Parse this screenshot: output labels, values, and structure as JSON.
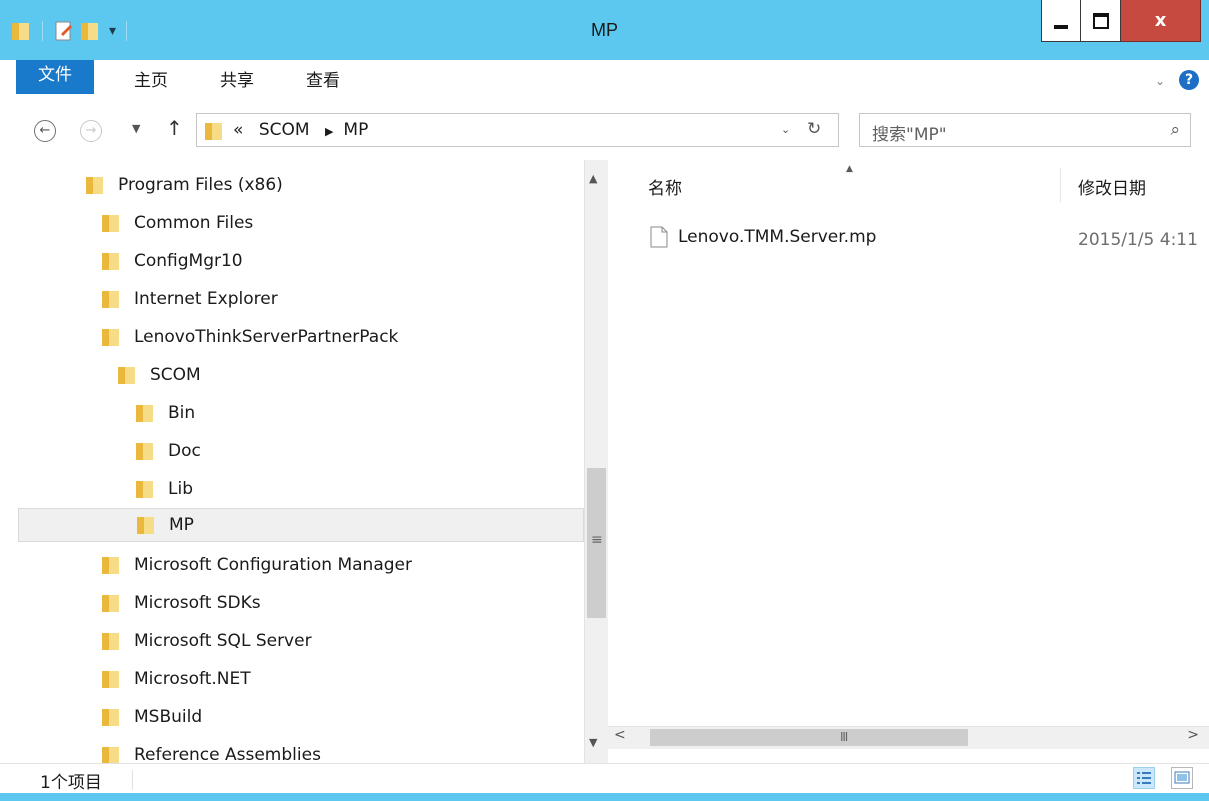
{
  "window": {
    "title": "MP"
  },
  "ribbon": {
    "tabs": [
      "文件",
      "主页",
      "共享",
      "查看"
    ]
  },
  "address": {
    "crumbs": [
      "«",
      "SCOM",
      "MP"
    ],
    "search_placeholder": "搜索\"MP\""
  },
  "nav_tree": [
    {
      "label": "Program Files (x86)",
      "level": 0
    },
    {
      "label": "Common Files",
      "level": 1
    },
    {
      "label": "ConfigMgr10",
      "level": 1
    },
    {
      "label": "Internet Explorer",
      "level": 1
    },
    {
      "label": "LenovoThinkServerPartnerPack",
      "level": 1
    },
    {
      "label": "SCOM",
      "level": 2
    },
    {
      "label": "Bin",
      "level": 3
    },
    {
      "label": "Doc",
      "level": 3
    },
    {
      "label": "Lib",
      "level": 3
    },
    {
      "label": "MP",
      "level": 3,
      "selected": true
    },
    {
      "label": "Microsoft Configuration Manager",
      "level": 1
    },
    {
      "label": "Microsoft SDKs",
      "level": 1
    },
    {
      "label": "Microsoft SQL Server",
      "level": 1
    },
    {
      "label": "Microsoft.NET",
      "level": 1
    },
    {
      "label": "MSBuild",
      "level": 1
    },
    {
      "label": "Reference Assemblies",
      "level": 1
    }
  ],
  "content": {
    "columns": [
      "名称",
      "修改日期"
    ],
    "files": [
      {
        "name": "Lenovo.TMM.Server.mp",
        "modified": "2015/1/5 4:11"
      }
    ]
  },
  "status": {
    "count": "1个项目"
  },
  "colors": {
    "chrome": "#5cc8f0",
    "file_tab": "#1979ca",
    "close": "#c64a3f",
    "folder": "#e9b83d"
  }
}
